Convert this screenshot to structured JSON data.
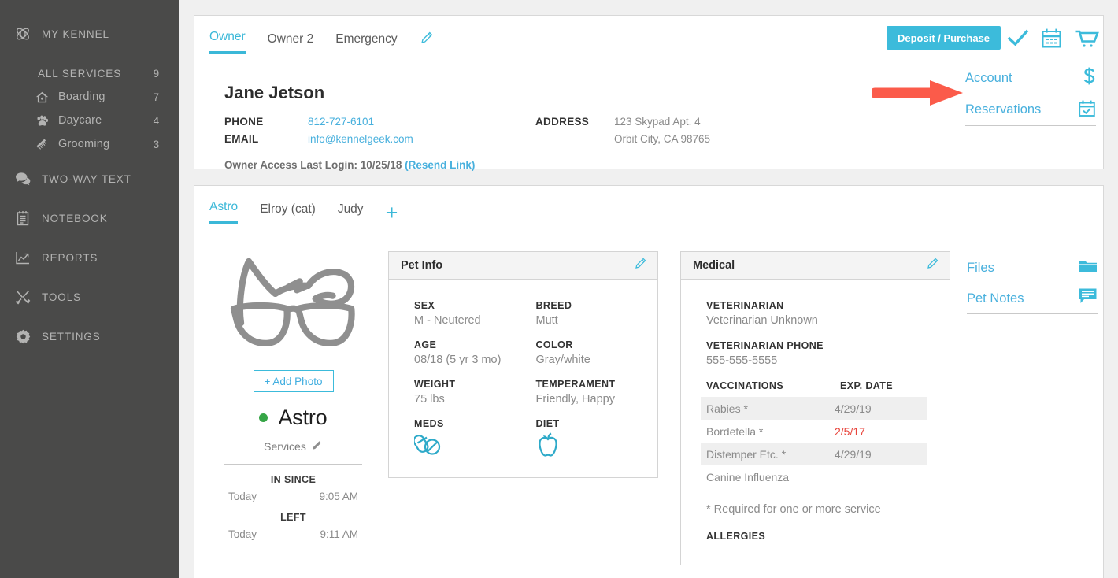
{
  "sidebar": {
    "top": {
      "label": "MY KENNEL",
      "icon": "kennel-logo-icon"
    },
    "services_header": {
      "label": "ALL SERVICES",
      "count": "9"
    },
    "services": [
      {
        "label": "Boarding",
        "count": "7",
        "icon": "house-icon"
      },
      {
        "label": "Daycare",
        "count": "4",
        "icon": "paw-icon"
      },
      {
        "label": "Grooming",
        "count": "3",
        "icon": "comb-icon"
      }
    ],
    "items": [
      {
        "label": "TWO-WAY TEXT",
        "icon": "chat-bubbles-icon"
      },
      {
        "label": "NOTEBOOK",
        "icon": "notebook-icon"
      },
      {
        "label": "REPORTS",
        "icon": "chart-line-icon"
      },
      {
        "label": "TOOLS",
        "icon": "tools-icon"
      },
      {
        "label": "SETTINGS",
        "icon": "gear-icon"
      }
    ]
  },
  "owner": {
    "tabs": [
      {
        "label": "Owner",
        "active": true
      },
      {
        "label": "Owner 2",
        "active": false
      },
      {
        "label": "Emergency",
        "active": false
      }
    ],
    "edit_icon": "pencil-icon",
    "name": "Jane Jetson",
    "phone_label": "PHONE",
    "phone_value": "812-727-6101",
    "email_label": "EMAIL",
    "email_value": "info@kennelgeek.com",
    "address_label": "ADDRESS",
    "address_line1": "123 Skypad Apt. 4",
    "address_line2": "Orbit City, CA 98765",
    "last_login_text": "Owner Access Last Login: 10/25/18 ",
    "resend_link": "(Resend Link)",
    "deposit_button": "Deposit / Purchase",
    "header_icons": [
      {
        "name": "checkmark-icon"
      },
      {
        "name": "calendar-icon"
      },
      {
        "name": "shopping-cart-icon"
      }
    ],
    "links": [
      {
        "label": "Account",
        "icon": "dollar-sign-icon"
      },
      {
        "label": "Reservations",
        "icon": "calendar-check-icon"
      }
    ]
  },
  "annotation": {
    "arrow_color": "#fb5b4a",
    "name": "red-arrow-pointing-to-account"
  },
  "pets": {
    "tabs": [
      {
        "label": "Astro",
        "active": true
      },
      {
        "label": "Elroy (cat)",
        "active": false
      },
      {
        "label": "Judy",
        "active": false
      }
    ],
    "add_tab_icon": "plus-icon",
    "avatar_icon": "dog-with-glasses-placeholder",
    "add_photo_button": "+ Add Photo",
    "name": "Astro",
    "status_color": "#36a546",
    "services_label": "Services",
    "services_icon": "pencil-icon",
    "in_since_label": "IN SINCE",
    "in_since_day": "Today",
    "in_since_time": "9:05 AM",
    "left_label": "LEFT",
    "left_day": "Today",
    "left_time": "9:11 AM"
  },
  "pet_info": {
    "title": "Pet Info",
    "edit_icon": "pencil-icon",
    "fields": [
      {
        "label": "SEX",
        "value": "M - Neutered"
      },
      {
        "label": "BREED",
        "value": "Mutt"
      },
      {
        "label": "AGE",
        "value": "08/18 (5 yr 3 mo)"
      },
      {
        "label": "COLOR",
        "value": "Gray/white"
      },
      {
        "label": "WEIGHT",
        "value": "75 lbs"
      },
      {
        "label": "TEMPERAMENT",
        "value": "Friendly, Happy"
      }
    ],
    "meds_label": "MEDS",
    "meds_icon": "pills-icon",
    "diet_label": "DIET",
    "diet_icon": "apple-icon"
  },
  "medical": {
    "title": "Medical",
    "edit_icon": "pencil-icon",
    "vet_label": "VETERINARIAN",
    "vet_value": "Veterinarian Unknown",
    "vet_phone_label": "VETERINARIAN PHONE",
    "vet_phone_value": "555-555-5555",
    "vaccinations_header": "VACCINATIONS",
    "exp_date_header": "EXP. DATE",
    "vaccinations": [
      {
        "name": "Rabies *",
        "date": "4/29/19",
        "expired": false
      },
      {
        "name": "Bordetella *",
        "date": "2/5/17",
        "expired": true
      },
      {
        "name": "Distemper Etc. *",
        "date": "4/29/19",
        "expired": false
      },
      {
        "name": "Canine Influenza",
        "date": "",
        "expired": false
      }
    ],
    "required_note": "* Required for one or more service",
    "allergies_label": "ALLERGIES",
    "expired_color": "#e8453c"
  },
  "pet_links": [
    {
      "label": "Files",
      "icon": "folder-icon"
    },
    {
      "label": "Pet Notes",
      "icon": "notes-bubble-icon"
    }
  ],
  "colors": {
    "accent": "#3cbbdb",
    "link": "#48b0dd",
    "sidebar_bg": "#4a4a49",
    "page_bg": "#f0f0f0"
  }
}
